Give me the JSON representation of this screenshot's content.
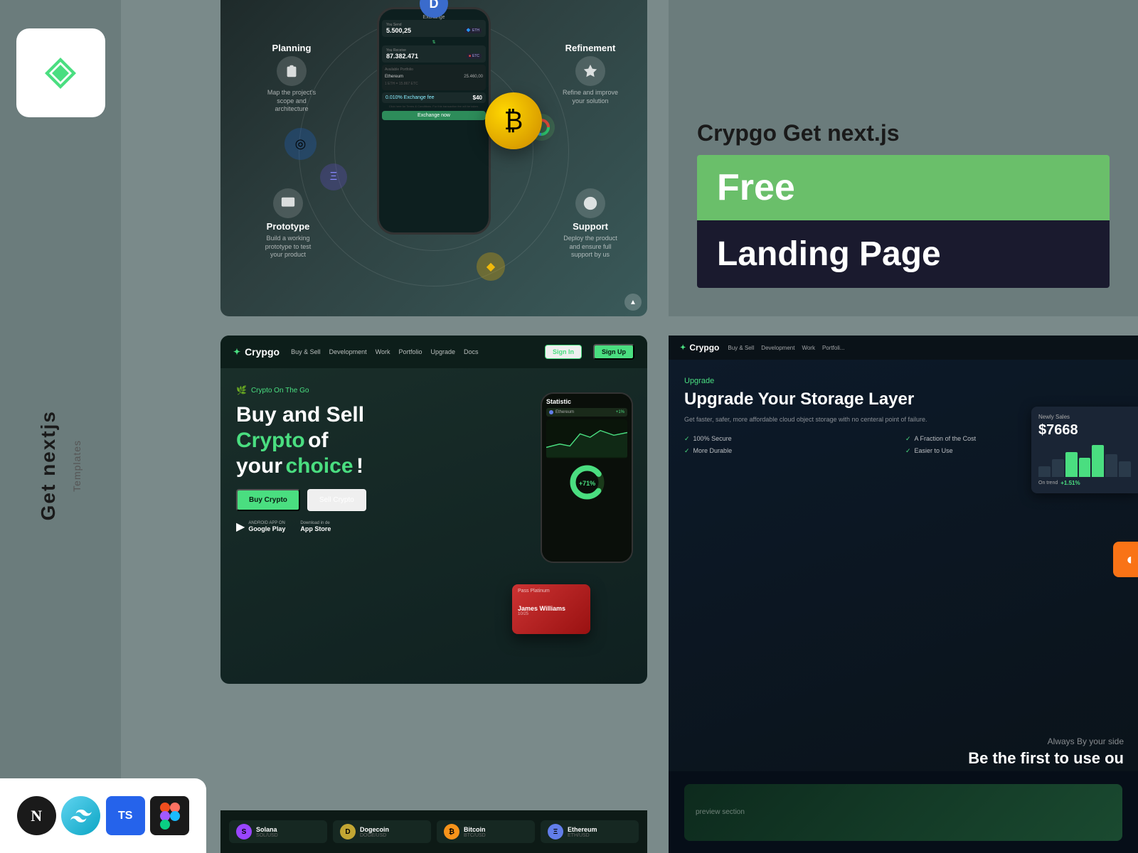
{
  "sidebar": {
    "main_text": "Get nextjs",
    "sub_text": "Templates",
    "logo_alt": "Gemini-like diamond logo"
  },
  "right_info": {
    "title": "Crypgo Get next.js",
    "free_label": "Free",
    "landing_label": "Landing Page"
  },
  "top_preview": {
    "d_icon": "D",
    "orbit": {
      "planning_label": "Planning",
      "planning_desc": "Map the project's scope and architecture",
      "refinement_label": "Refinement",
      "refinement_desc": "Refine and improve your solution",
      "prototype_label": "Prototype",
      "prototype_desc": "Build a working prototype to test your product",
      "support_label": "Support",
      "support_desc": "Deploy the product and ensure full support by us"
    },
    "phone": {
      "header": "Exchange",
      "you_send_label": "You Send",
      "you_send_val": "5.500,25",
      "token1": "ETH",
      "you_receive_label": "You Receive",
      "you_receive_val": "87.382.471",
      "token2": "ETC",
      "portfolio_label": "Available Portfolio",
      "ethereum_label": "Ethereum",
      "ethereum_val": "25.460,00",
      "fee_label": "0.010% Exchange fee",
      "fee_val": "$40",
      "exchange_btn": "Exchange now"
    }
  },
  "bottom_left": {
    "nav": {
      "logo": "Crypgo",
      "items": [
        "Buy & Sell",
        "Development",
        "Work",
        "Portfolio",
        "Upgrade",
        "Docs"
      ],
      "signin": "Sign In",
      "signup": "Sign Up"
    },
    "hero": {
      "tag": "Crypto On The Go",
      "line1": "Buy and Sell",
      "line2": "Crypto",
      "line3": "of",
      "line4": "your",
      "choice": "choice",
      "exclaim": "!",
      "buy_btn": "Buy Crypto",
      "sell_btn": "Sell Crypto"
    },
    "stores": {
      "google_top": "ANDROID APP ON",
      "google_bot": "Google Play",
      "apple_top": "Download in de",
      "apple_bot": "App Store"
    },
    "card": {
      "label": "Pass Platinum",
      "name": "James Williams",
      "number": "10/25"
    },
    "tickers": [
      {
        "icon": "S",
        "name": "Solana",
        "sub": "SOL/USD",
        "color": "#9945FF"
      },
      {
        "icon": "D",
        "name": "Dogecoin",
        "sub": "DOGE/USD",
        "color": "#C2A633"
      },
      {
        "icon": "₿",
        "name": "Bitcoin",
        "sub": "BTC/USD",
        "color": "#F7931A"
      },
      {
        "icon": "Ξ",
        "name": "Ethereum",
        "sub": "ETH/USD",
        "color": "#627EEA"
      }
    ]
  },
  "bottom_right": {
    "nav": {
      "logo": "Crypgo",
      "items": [
        "Buy & Sell",
        "Development",
        "Work",
        "Portfoli..."
      ]
    },
    "upgrade_label": "Upgrade",
    "title": "Upgrade Your Storage Layer",
    "desc": "Get faster, safer, more affordable cloud object storage with no centeral point of failure.",
    "features": [
      "100% Secure",
      "A Fraction of the Cost",
      "More Durable",
      "Easier to Use"
    ],
    "price": "$7668",
    "change": "+1.51%",
    "always_text": "Always By your side",
    "be_first_text": "Be the first to use ou"
  },
  "bottom_icons": {
    "n_letter": "N",
    "ts_text": "TS",
    "fig_icon": "◻"
  }
}
